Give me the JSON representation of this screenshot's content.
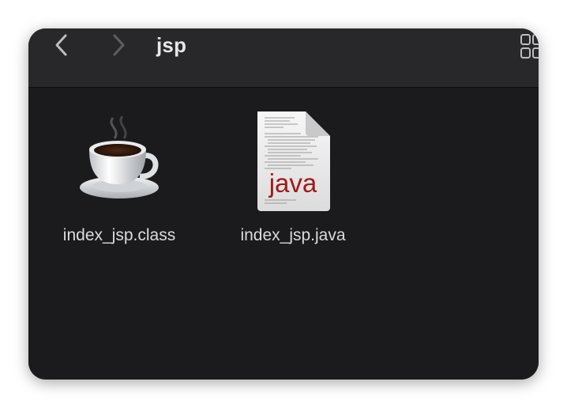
{
  "window": {
    "title": "jsp"
  },
  "toolbar": {
    "back_icon": "chevron-left-icon",
    "forward_icon": "chevron-right-icon",
    "view_icon": "grid-view-icon"
  },
  "files": [
    {
      "name": "index_jsp.class",
      "icon": "java-coffee-cup-icon"
    },
    {
      "name": "index_jsp.java",
      "icon": "java-source-document-icon",
      "badge": "java"
    }
  ],
  "colors": {
    "window_bg": "#1b1b1d",
    "toolbar_bg": "#28282a",
    "java_badge": "#a01a1a"
  }
}
